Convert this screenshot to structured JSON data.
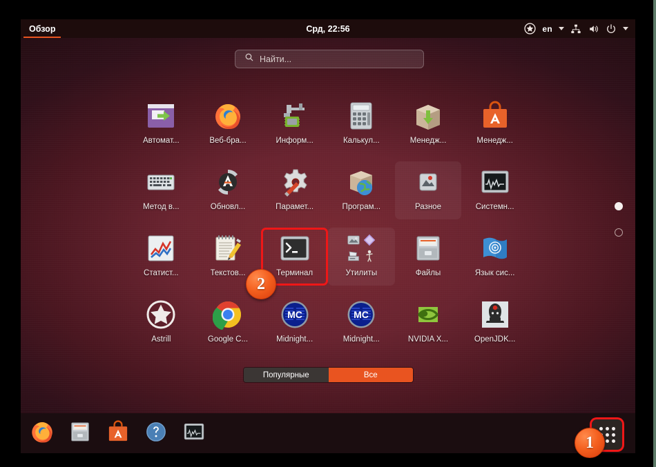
{
  "topbar": {
    "overview_label": "Обзор",
    "clock": "Срд, 22:56",
    "language": "en",
    "icons": [
      "shield-star-icon",
      "network-icon",
      "volume-icon",
      "power-icon",
      "chevron-down-icon"
    ]
  },
  "search": {
    "placeholder": "Найти...",
    "icon": "search-icon"
  },
  "apps": [
    {
      "label": "Автомат...",
      "icon": "automation-icon",
      "folder": false,
      "highlight": false
    },
    {
      "label": "Веб-бра...",
      "icon": "firefox-icon",
      "folder": false,
      "highlight": false
    },
    {
      "label": "Информ...",
      "icon": "hardware-info-icon",
      "folder": false,
      "highlight": false
    },
    {
      "label": "Калькул...",
      "icon": "calculator-icon",
      "folder": false,
      "highlight": false
    },
    {
      "label": "Менедж...",
      "icon": "package-download-icon",
      "folder": false,
      "highlight": false
    },
    {
      "label": "Менедж...",
      "icon": "ubuntu-software-icon",
      "folder": false,
      "highlight": false
    },
    {
      "label": "Метод в...",
      "icon": "keyboard-icon",
      "folder": false,
      "highlight": false
    },
    {
      "label": "Обновл...",
      "icon": "software-updater-icon",
      "folder": false,
      "highlight": false
    },
    {
      "label": "Парамет...",
      "icon": "settings-gear-icon",
      "folder": false,
      "highlight": false
    },
    {
      "label": "Програм...",
      "icon": "package-globe-icon",
      "folder": false,
      "highlight": false
    },
    {
      "label": "Разное",
      "icon": "misc-folder-icon",
      "folder": true,
      "highlight": false
    },
    {
      "label": "Системн...",
      "icon": "system-monitor-icon",
      "folder": false,
      "highlight": false
    },
    {
      "label": "Статист...",
      "icon": "statistics-icon",
      "folder": false,
      "highlight": false
    },
    {
      "label": "Текстов...",
      "icon": "text-editor-icon",
      "folder": false,
      "highlight": false
    },
    {
      "label": "Терминал",
      "icon": "terminal-icon",
      "folder": false,
      "highlight": true
    },
    {
      "label": "Утилиты",
      "icon": "utilities-folder-icon",
      "folder": true,
      "highlight": false
    },
    {
      "label": "Файлы",
      "icon": "files-icon",
      "folder": false,
      "highlight": false
    },
    {
      "label": "Язык сис...",
      "icon": "language-support-icon",
      "folder": false,
      "highlight": false
    },
    {
      "label": "Astrill",
      "icon": "astrill-star-icon",
      "folder": false,
      "highlight": false
    },
    {
      "label": "Google C...",
      "icon": "google-chrome-icon",
      "folder": false,
      "highlight": false
    },
    {
      "label": "Midnight...",
      "icon": "midnight-commander-icon",
      "folder": false,
      "highlight": false
    },
    {
      "label": "Midnight...",
      "icon": "midnight-commander-icon",
      "folder": false,
      "highlight": false
    },
    {
      "label": "NVIDIA X...",
      "icon": "nvidia-icon",
      "folder": false,
      "highlight": false
    },
    {
      "label": "OpenJDK...",
      "icon": "openjdk-duke-icon",
      "folder": false,
      "highlight": false
    }
  ],
  "page_indicator": {
    "total": 2,
    "current": 1
  },
  "toggle": {
    "frequent_label": "Популярные",
    "all_label": "Все",
    "selected": "Все"
  },
  "dock": {
    "items": [
      {
        "name": "firefox",
        "icon": "firefox-icon"
      },
      {
        "name": "files",
        "icon": "files-icon"
      },
      {
        "name": "ubuntu-software",
        "icon": "ubuntu-software-icon"
      },
      {
        "name": "help",
        "icon": "help-question-icon"
      },
      {
        "name": "system-monitor",
        "icon": "system-monitor-icon"
      }
    ],
    "show_apps": {
      "icon": "grid-apps-icon",
      "highlight": true
    }
  },
  "annotations": [
    {
      "step": "1",
      "target": "show-apps-button"
    },
    {
      "step": "2",
      "target": "terminal-app"
    }
  ],
  "colors": {
    "accent_orange": "#e95420",
    "highlight_red": "#ef1717",
    "topbar_bg": "#1d0c0c",
    "wallpaper_center": "#7a2a33",
    "wallpaper_edge": "#250d13"
  }
}
